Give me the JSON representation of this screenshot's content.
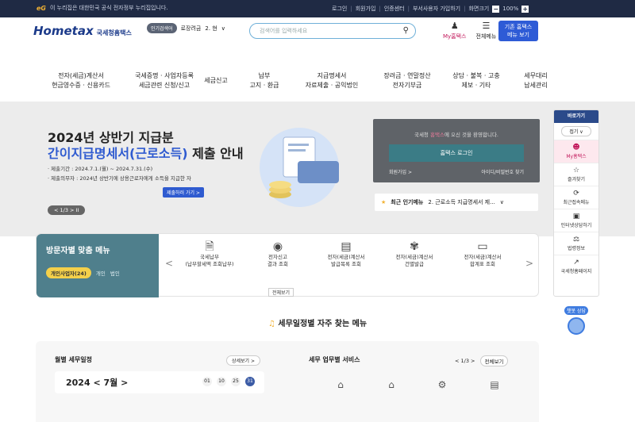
{
  "topbar": {
    "eg_mark": "eG",
    "gov_text": "이 누리집은 대한민국 공식 전자정부 누리집입니다.",
    "links": [
      "로그인",
      "회원가입",
      "인증센터",
      "부서사용자 가입하기",
      "화면크기"
    ],
    "zoom_minus": "−",
    "zoom_value": "100%",
    "zoom_plus": "+"
  },
  "header": {
    "logo_main": "Hometax",
    "logo_sub": "국세청홈택스",
    "popular_pill": "인기검색어",
    "popular_keyword": "로장려금",
    "popular_rank": "2. 현",
    "popular_caret": "∨",
    "search_placeholder": "검색어를 입력하세요",
    "search_icon": "search-icon",
    "my_label": "My홈택스",
    "menu_label": "전체메뉴",
    "old_line1": "기존 홈택스",
    "old_line2": "메뉴 보기"
  },
  "gnb": [
    {
      "line1": "전자(세금)계산서",
      "line2": "현금영수증 · 신용카드"
    },
    {
      "line1": "국세증명 · 사업자등록",
      "line2": "세금관련 신청/신고"
    },
    {
      "line1": "세금신고",
      "line2": ""
    },
    {
      "line1": "납부",
      "line2": "고지 · 환급"
    },
    {
      "line1": "지급명세서",
      "line2": "자료제출 · 공익법인"
    },
    {
      "line1": "장려금 · 연말정산",
      "line2": "전자기부금"
    },
    {
      "line1": "상담 · 불복 · 고충",
      "line2": "제보 · 기타"
    },
    {
      "line1": "세무대리",
      "line2": "납세관리"
    }
  ],
  "hero": {
    "title1": "2024년 상반기 지급분",
    "title2_blue": "간이지급명세서(근로소득)",
    "title2_rest": " 제출 안내",
    "desc1": "· 제출기간 : 2024.7.1.(월) ~ 2024.7.31.(수)",
    "desc2": "· 제출의무자 : 2024년 상반기에 상용근로자에게 소득을 지급한 자",
    "go_label": "제출하러 가기 >",
    "pager": "< 1/3 > II"
  },
  "login": {
    "welcome_pre": "국세청 ",
    "welcome_hl": "홈택스",
    "welcome_post": "에 오신 것을 환영합니다.",
    "button": "홈택스 로그인",
    "join": "회원가입 >",
    "find": "아이디/비밀번호 찾기"
  },
  "recent": {
    "label": "최근 인기메뉴",
    "item": "2. 근로소득 지급명세서 제...",
    "caret": "∨"
  },
  "quick": {
    "title": "바로가기",
    "fold": "접기 ∨",
    "items": [
      {
        "label": "My홈택스",
        "icon": "user-icon"
      },
      {
        "label": "즐겨찾기",
        "icon": "star-icon"
      },
      {
        "label": "최근접속메뉴",
        "icon": "recent-icon"
      },
      {
        "label": "인터넷상담하기",
        "icon": "monitor-icon"
      },
      {
        "label": "법령정보",
        "icon": "scale-icon"
      },
      {
        "label": "국세청홈페이지",
        "icon": "external-icon"
      }
    ],
    "chat_label": "챗봇 상담"
  },
  "visitor": {
    "title": "방문자별 맞춤 메뉴",
    "tabs": [
      "개인사업자(24)",
      "개인",
      "법인"
    ],
    "services": [
      {
        "line1": "국세납부",
        "line2": "(납부할세액 조회납부)",
        "icon": "document-icon"
      },
      {
        "line1": "전자신고",
        "line2": "결과 조회",
        "icon": "money-bag-icon"
      },
      {
        "line1": "전자(세금)계산서",
        "line2": "발급목록 조회",
        "icon": "invoice-icon"
      },
      {
        "line1": "전자(세금)계산서",
        "line2": "건별발급",
        "icon": "handshake-icon"
      },
      {
        "line1": "전자(세금)계산서",
        "line2": "합계표 조회",
        "icon": "folder-icon"
      }
    ],
    "all_label": "전체보기",
    "prev": "<",
    "next": ">"
  },
  "freq_title": "세무일정별 자주 찾는 메뉴",
  "monthly": {
    "title": "월별 세무일정",
    "more": "상세보기 >",
    "year_month": "2024 < 7월 >",
    "days": [
      "01",
      "10",
      "25",
      "31"
    ]
  },
  "services": {
    "title": "세무 업무별 서비스",
    "pager": "< 1/3 >",
    "all": "전체보기"
  }
}
